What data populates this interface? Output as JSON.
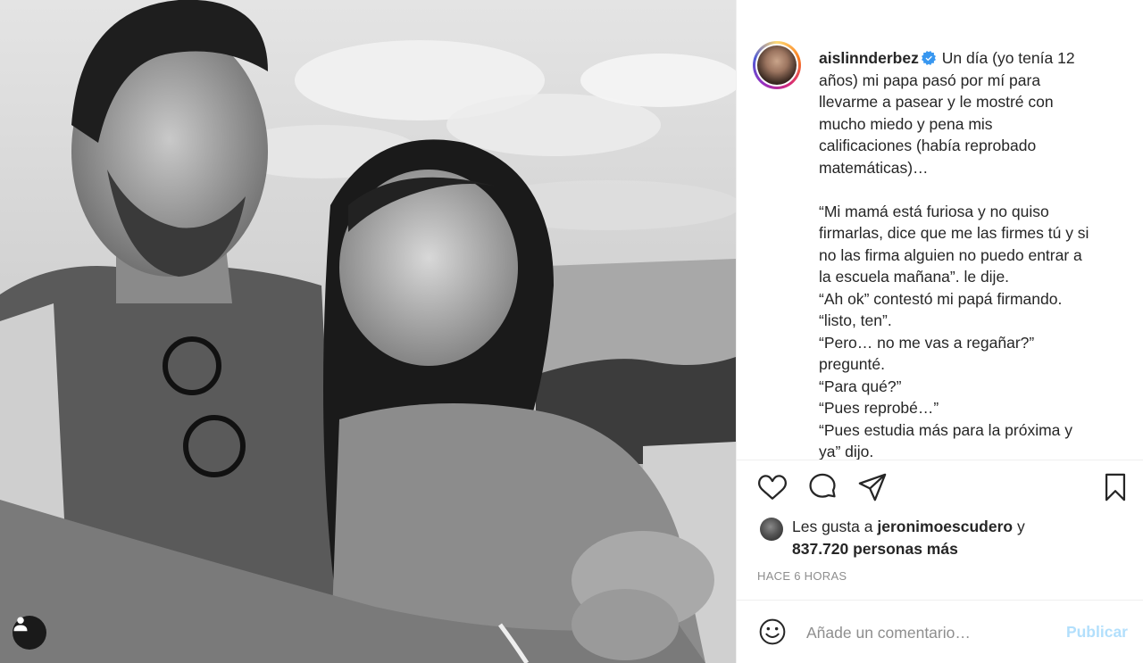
{
  "post": {
    "username": "aislinnderbez",
    "verified": true,
    "caption_lines": [
      " Un día (yo tenía 12",
      "años) mi papa pasó por mí para",
      "llevarme a pasear y le mostré con",
      "mucho miedo y pena mis",
      "calificaciones (había reprobado",
      "matemáticas)…",
      "",
      "“Mi mamá está furiosa y no quiso",
      "firmarlas, dice que me las firmes tú y si",
      "no las firma alguien no puedo entrar a",
      "la escuela mañana”. le dije.",
      "“Ah ok” contestó mi papá firmando.",
      "“listo, ten”.",
      "“Pero… no me vas a regañar?”",
      "pregunté.",
      "“Para qué?”",
      "“Pues reprobé…”",
      "“Pues estudia más para la próxima y",
      "ya” dijo."
    ]
  },
  "actions": {
    "like_icon": "heart-icon",
    "comment_icon": "comment-icon",
    "share_icon": "paper-plane-icon",
    "save_icon": "bookmark-icon"
  },
  "likes": {
    "prefix": "Les gusta a ",
    "user": "jeronimoescudero",
    "joiner": " y",
    "count": "837.720 personas más"
  },
  "timestamp": "HACE 6 HORAS",
  "comment": {
    "placeholder": "Añade un comentario…",
    "publish_label": "Publicar",
    "emoji_icon": "smiley-icon"
  },
  "colors": {
    "accent_blue": "#0095f6",
    "publish_disabled": "#b2dffc",
    "muted": "#8e8e8e",
    "text": "#262626"
  }
}
